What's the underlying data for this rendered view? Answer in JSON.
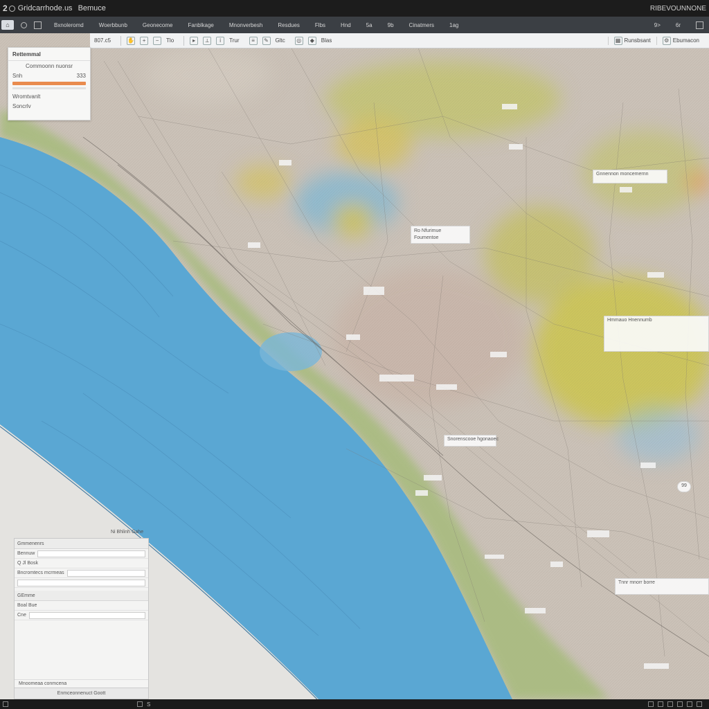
{
  "titlebar": {
    "number": "2",
    "title": "Gridcarrhode.us",
    "subtitle": "Bemuce",
    "right_text": "RIBEVOUNNONE"
  },
  "menubar": {
    "items": [
      "Bxnoleromd",
      "Woerbbunb",
      "Geonecome",
      "Fanblkage",
      "Mnonverbesh",
      "Resdues",
      "Flbs",
      "Hnd",
      "5a",
      "9b",
      "Cinatmers",
      "1ag"
    ],
    "right_items": [
      "9>",
      "6r"
    ]
  },
  "toolbar": {
    "zoom_label": "807.c5",
    "items": [
      "Tlo",
      "Trur",
      "Gltc",
      "Blas"
    ],
    "right_buttons": [
      "Runsbsant",
      "Ebumacon"
    ]
  },
  "layers_panel": {
    "title": "Rettemmal",
    "subtitle": "Commoonn nuonsr",
    "row_label": "Snh",
    "row_value": "333",
    "bottom_label": "Wromtvanlt",
    "bottom_sub": "Soncrlv"
  },
  "map_labels": {
    "l1": "Ro Nfurimue",
    "l1b": "Foumentoe",
    "l2": "Gnnennon moncemernn",
    "l3": "Hmmauo Hnennumb",
    "l4": "Snorenscooe hgonaoec",
    "l5": "Ucmamnoor",
    "l6": "Tnnr mnorr borre",
    "compass": "99"
  },
  "props_panel": {
    "caption": "Ni Bhlinh Gahe",
    "section1": "Gmmenenrs",
    "field1": "Bennuw",
    "row1": "Q Jl  Bosk",
    "row2": "Bncromtecs mcrmeas",
    "section2": "GEmme",
    "row3": "Boal Bue",
    "row4": "Cne",
    "footer_text": "Mnoomeaa conmcena",
    "status_text": "Enmceonnenuct Goott"
  },
  "taskbar": {
    "items": [
      "S"
    ]
  },
  "colors": {
    "ocean": "#5aa7d3",
    "land": "#cbc2b8",
    "coastal_green": "#a8bb7f",
    "yellow_zone": "#c7c363",
    "orange_accent": "#e98b4e"
  }
}
